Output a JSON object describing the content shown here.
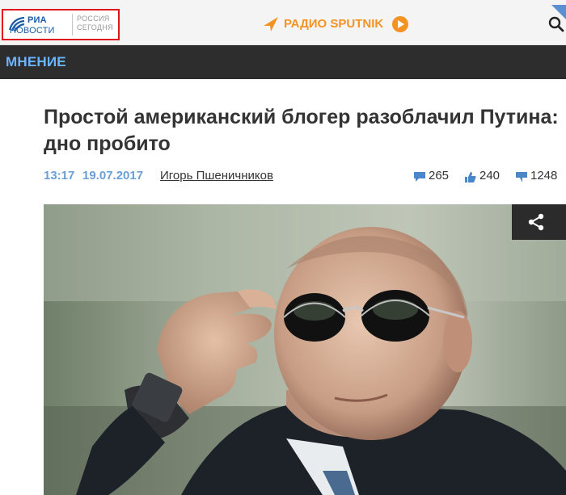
{
  "header": {
    "logo": {
      "line1": "РИА",
      "line2": "НОВОСТИ",
      "secondary_line1": "РОССИЯ",
      "secondary_line2": "СЕГОДНЯ"
    },
    "radio": {
      "label": "РАДИО SPUTNIK"
    },
    "search_icon": "search-icon"
  },
  "section": {
    "label": "МНЕНИЕ"
  },
  "article": {
    "headline": "Простой американский блогер разоблачил Путина: дно пробито",
    "time": "13:17",
    "date": "19.07.2017",
    "author": "Игорь Пшеничников",
    "stats": {
      "comments": "265",
      "likes": "240",
      "views": "1248"
    },
    "image_alt": "photo"
  },
  "colors": {
    "brand_red": "#e0141e",
    "radio_orange": "#f39422",
    "section_bg": "#2d2d2d",
    "section_text": "#6cb4ff",
    "meta_blue": "#6a9fd6",
    "stat_icon_blue": "#4a86c8"
  },
  "icons": [
    "globe-icon",
    "sputnik-arrow-icon",
    "play-icon",
    "search-icon",
    "comment-icon",
    "like-icon",
    "view-icon",
    "share-icon"
  ]
}
